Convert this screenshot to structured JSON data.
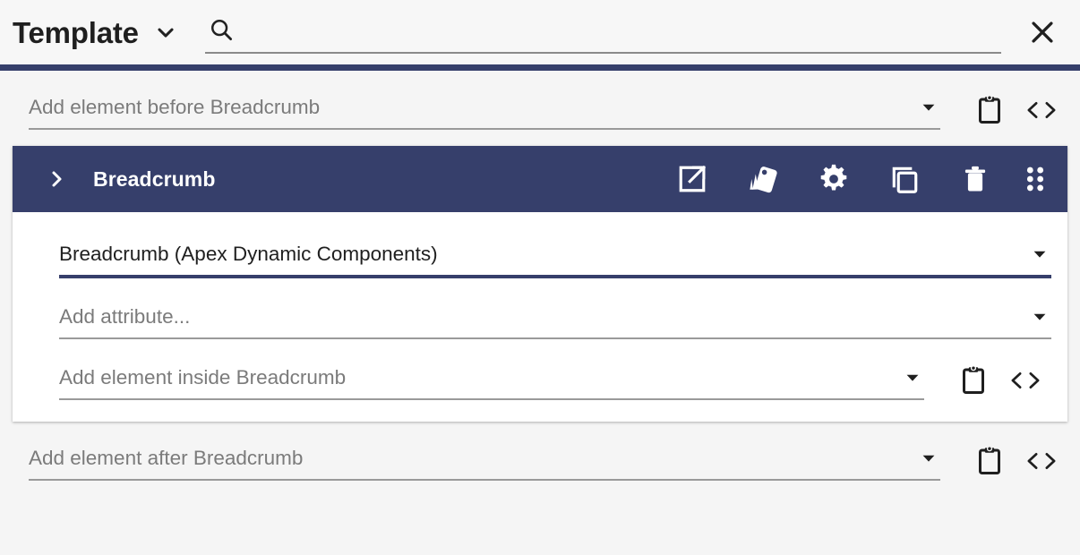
{
  "header": {
    "title": "Template",
    "title_caret_icon": "chevron-down-icon",
    "search_icon": "search-icon",
    "search_value": "",
    "search_placeholder": "",
    "close_icon": "close-icon",
    "accent_color": "#363f6b"
  },
  "rows": {
    "before": {
      "label": "Add element before Breadcrumb",
      "caret_icon": "chevron-down-icon",
      "paste_icon": "clipboard-paste-icon",
      "code_icon": "code-brackets-icon"
    },
    "after": {
      "label": "Add element after Breadcrumb",
      "caret_icon": "chevron-down-icon",
      "paste_icon": "clipboard-paste-icon",
      "code_icon": "code-brackets-icon"
    }
  },
  "element_card": {
    "title": "Breadcrumb",
    "expander_icon": "chevron-right-icon",
    "header_color": "#363f6b",
    "actions": [
      {
        "name": "open-external-icon",
        "label": "Open"
      },
      {
        "name": "style-palette-icon",
        "label": "Style"
      },
      {
        "name": "gear-icon",
        "label": "Settings"
      },
      {
        "name": "copy-icon",
        "label": "Duplicate"
      },
      {
        "name": "trash-icon",
        "label": "Delete"
      },
      {
        "name": "drag-handle-icon",
        "label": "Reorder"
      }
    ],
    "component_select": {
      "value": "Breadcrumb (Apex Dynamic Components)",
      "caret_icon": "chevron-down-icon",
      "active": true
    },
    "attribute_select": {
      "label": "Add attribute...",
      "caret_icon": "chevron-down-icon"
    },
    "inside_row": {
      "label": "Add element inside Breadcrumb",
      "caret_icon": "chevron-down-icon",
      "paste_icon": "clipboard-paste-icon",
      "code_icon": "code-brackets-icon"
    }
  }
}
